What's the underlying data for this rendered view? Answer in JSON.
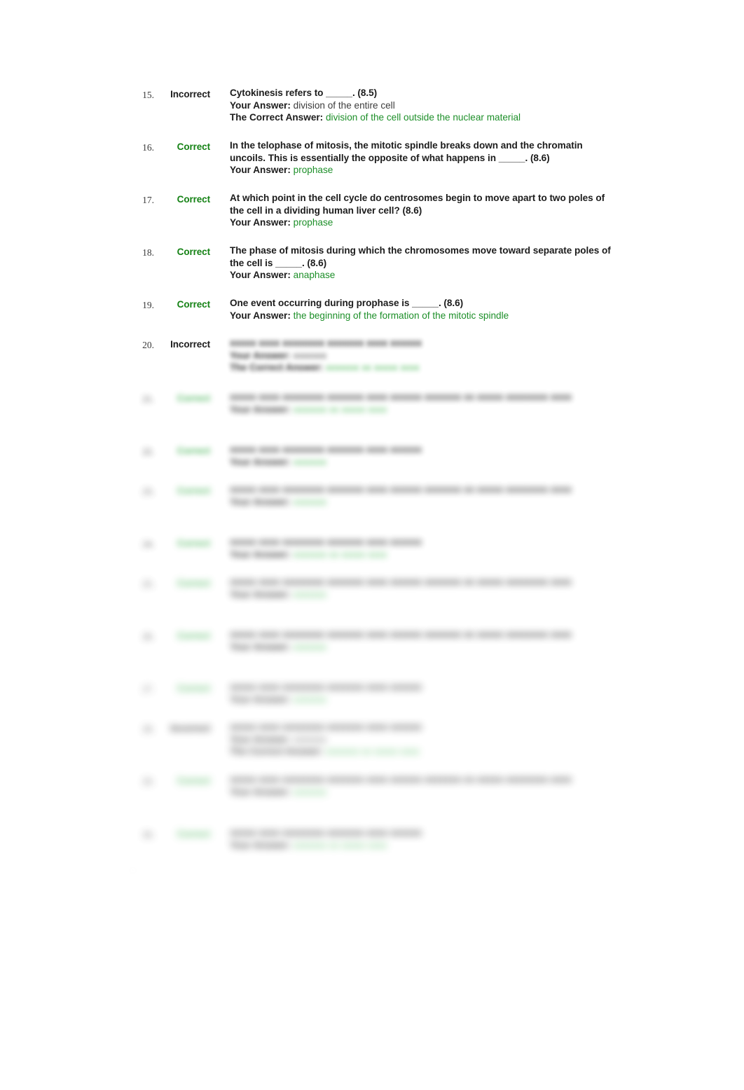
{
  "page": {
    "background_color": "#ffffff",
    "correct_color": "#158215",
    "incorrect_color": "#1c1c1c",
    "answer_green": "#1d8f29"
  },
  "labels": {
    "your_answer": "Your Answer:",
    "correct_answer": "The Correct Answer:",
    "status_correct": "Correct",
    "status_incorrect": "Incorrect",
    "blank": "_____"
  },
  "questions": [
    {
      "number": "15.",
      "status": "Incorrect",
      "text_before_blank": "Cytokinesis refers to ",
      "blank": "_____",
      "text_after_blank": ". (8.5)",
      "your_answer_label": "Your Answer:",
      "your_answer": "division of the entire cell",
      "correct_answer_label": "The Correct Answer:",
      "correct_answer": "division of the cell outside the nuclear material",
      "blur": "none"
    },
    {
      "number": "16.",
      "status": "Correct",
      "text_before_blank": "In the telophase of mitosis, the mitotic spindle breaks down and the chromatin uncoils. This is essentially the opposite of what happens in ",
      "blank": "_____",
      "text_after_blank": ". (8.6)",
      "your_answer_label": "Your Answer:",
      "your_answer": "prophase",
      "correct_answer_label": "",
      "correct_answer": "",
      "blur": "none"
    },
    {
      "number": "17.",
      "status": "Correct",
      "text_before_blank": "At which point in the cell cycle do centrosomes begin to move apart to two poles of the cell in a dividing human liver cell? (8.6)",
      "blank": "",
      "text_after_blank": "",
      "your_answer_label": "Your Answer:",
      "your_answer": "prophase",
      "correct_answer_label": "",
      "correct_answer": "",
      "blur": "none"
    },
    {
      "number": "18.",
      "status": "Correct",
      "text_before_blank": "The phase of mitosis during which the chromosomes move toward separate poles of the cell is ",
      "blank": "_____",
      "text_after_blank": ". (8.6)",
      "your_answer_label": "Your Answer:",
      "your_answer": "anaphase",
      "correct_answer_label": "",
      "correct_answer": "",
      "blur": "none"
    },
    {
      "number": "19.",
      "status": "Correct",
      "text_before_blank": "One event occurring during prophase is ",
      "blank": "_____",
      "text_after_blank": ". (8.6)",
      "your_answer_label": "Your Answer:",
      "your_answer": "the beginning of the formation of the mitotic spindle",
      "correct_answer_label": "",
      "correct_answer": "",
      "blur": "none"
    },
    {
      "number": "20.",
      "status": "Incorrect",
      "text_before_blank": "",
      "blank": "",
      "text_after_blank": "",
      "your_answer_label": "",
      "your_answer": "",
      "correct_answer_label": "",
      "correct_answer": "",
      "blur": "light"
    },
    {
      "number": "21.",
      "status": "Correct",
      "text_before_blank": "",
      "blank": "",
      "text_after_blank": "",
      "your_answer_label": "",
      "your_answer": "",
      "correct_answer_label": "",
      "correct_answer": "",
      "blur": "medium"
    },
    {
      "number": "22.",
      "status": "Correct",
      "text_before_blank": "",
      "blank": "",
      "text_after_blank": "",
      "your_answer_label": "",
      "your_answer": "",
      "correct_answer_label": "",
      "correct_answer": "",
      "blur": "medium"
    },
    {
      "number": "23.",
      "status": "Correct",
      "text_before_blank": "",
      "blank": "",
      "text_after_blank": "",
      "your_answer_label": "",
      "your_answer": "",
      "correct_answer_label": "",
      "correct_answer": "",
      "blur": "medium"
    },
    {
      "number": "24.",
      "status": "Correct",
      "text_before_blank": "",
      "blank": "",
      "text_after_blank": "",
      "your_answer_label": "",
      "your_answer": "",
      "correct_answer_label": "",
      "correct_answer": "",
      "blur": "heavy"
    },
    {
      "number": "25.",
      "status": "Correct",
      "text_before_blank": "",
      "blank": "",
      "text_after_blank": "",
      "your_answer_label": "",
      "your_answer": "",
      "correct_answer_label": "",
      "correct_answer": "",
      "blur": "heavy"
    },
    {
      "number": "26.",
      "status": "Correct",
      "text_before_blank": "",
      "blank": "",
      "text_after_blank": "",
      "your_answer_label": "",
      "your_answer": "",
      "correct_answer_label": "",
      "correct_answer": "",
      "blur": "heavy"
    },
    {
      "number": "27.",
      "status": "Correct",
      "text_before_blank": "",
      "blank": "",
      "text_after_blank": "",
      "your_answer_label": "",
      "your_answer": "",
      "correct_answer_label": "",
      "correct_answer": "",
      "blur": "heavy"
    },
    {
      "number": "28.",
      "status": "Incorrect",
      "text_before_blank": "",
      "blank": "",
      "text_after_blank": "",
      "your_answer_label": "",
      "your_answer": "",
      "correct_answer_label": "",
      "correct_answer": "",
      "blur": "heavy"
    },
    {
      "number": "29.",
      "status": "Correct",
      "text_before_blank": "",
      "blank": "",
      "text_after_blank": "",
      "your_answer_label": "",
      "your_answer": "",
      "correct_answer_label": "",
      "correct_answer": "",
      "blur": "heavy"
    },
    {
      "number": "30.",
      "status": "Correct",
      "text_before_blank": "",
      "blank": "",
      "text_after_blank": "",
      "your_answer_label": "",
      "your_answer": "",
      "correct_answer_label": "",
      "correct_answer": "",
      "blur": "heavy"
    }
  ],
  "redacted": {
    "placeholder_question_long": "xxxxx xxxx xxxxxxxx xxxxxxx xxxx xxxxxx xxxxxxx xx xxxxx xxxxxxxx xxxx",
    "placeholder_question_short": "xxxxx xxxx xxxxxxxx xxxxxxx xxxx xxxxxx",
    "placeholder_answer": "xxxxxxx xx xxxxx xxxx",
    "placeholder_answer_short": "xxxxxxx"
  }
}
